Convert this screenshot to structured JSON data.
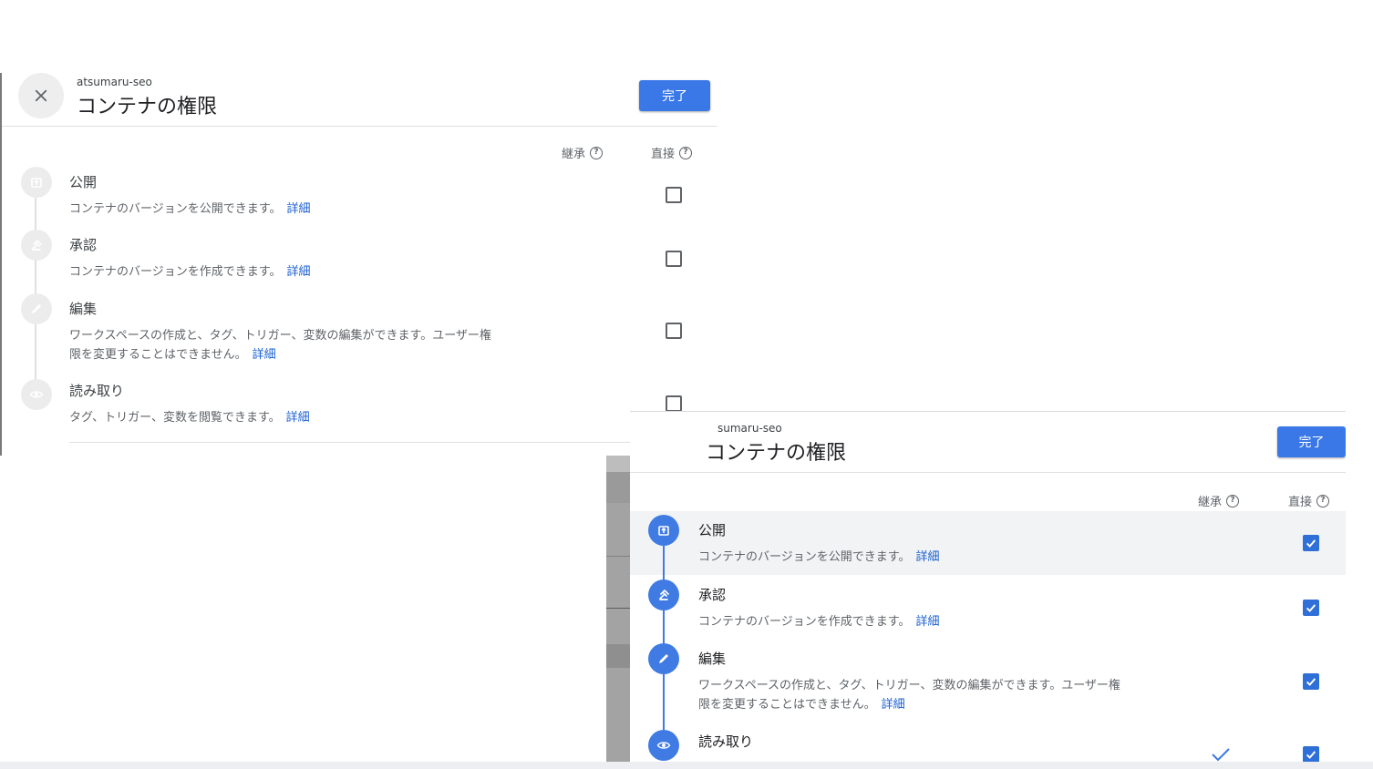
{
  "colors": {
    "accent": "#3b78e7",
    "link": "#1a5fd0",
    "step_icon_active": "#3f7be3",
    "step_icon_inactive": "#ececec",
    "row_highlight": "#f1f3f4"
  },
  "panel_a": {
    "account": "atsumaru-seo",
    "title": "コンテナの権限",
    "done_label": "完了",
    "close_icon": "close-icon",
    "col_inherited": "継承",
    "col_direct": "直接",
    "roles": [
      {
        "icon": "publish-icon",
        "name": "公開",
        "desc": "コンテナのバージョンを公開できます。",
        "link": "詳細",
        "direct": false
      },
      {
        "icon": "gavel-icon",
        "name": "承認",
        "desc": "コンテナのバージョンを作成できます。",
        "link": "詳細",
        "direct": false
      },
      {
        "icon": "pencil-icon",
        "name": "編集",
        "desc_line1": "ワークスペースの作成と、タグ、トリガー、変数の編集ができます。ユーザー権",
        "desc_line2": "限を変更することはできません。",
        "link": "詳細",
        "direct": false
      },
      {
        "icon": "eye-icon",
        "name": "読み取り",
        "desc": "タグ、トリガー、変数を閲覧できます。",
        "link": "詳細",
        "direct": false
      }
    ]
  },
  "panel_b": {
    "account": "sumaru-seo",
    "title": "コンテナの権限",
    "done_label": "完了",
    "col_inherited": "継承",
    "col_direct": "直接",
    "roles": [
      {
        "icon": "publish-icon",
        "name": "公開",
        "desc": "コンテナのバージョンを公開できます。",
        "link": "詳細",
        "direct": true,
        "highlighted": true
      },
      {
        "icon": "gavel-icon",
        "name": "承認",
        "desc": "コンテナのバージョンを作成できます。",
        "link": "詳細",
        "direct": true
      },
      {
        "icon": "pencil-icon",
        "name": "編集",
        "desc_line1": "ワークスペースの作成と、タグ、トリガー、変数の編集ができます。ユーザー権",
        "desc_line2": "限を変更することはできません。",
        "link": "詳細",
        "direct": true
      },
      {
        "icon": "eye-icon",
        "name": "読み取り",
        "direct": true,
        "inherited": true
      }
    ]
  }
}
